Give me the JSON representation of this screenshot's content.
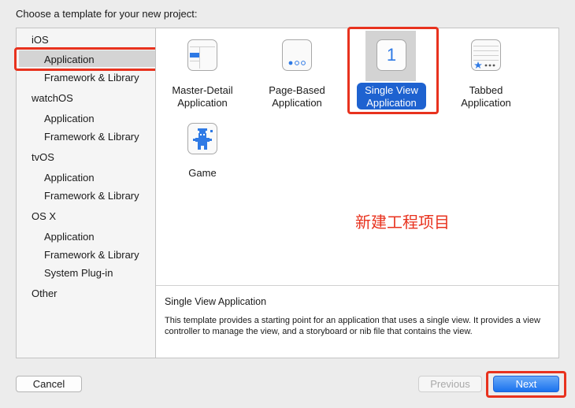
{
  "header": {
    "title": "Choose a template for your new project:"
  },
  "sidebar": {
    "items": [
      {
        "label": "iOS"
      },
      {
        "label": "Application"
      },
      {
        "label": "Framework & Library"
      },
      {
        "label": "watchOS"
      },
      {
        "label": "Application"
      },
      {
        "label": "Framework & Library"
      },
      {
        "label": "tvOS"
      },
      {
        "label": "Application"
      },
      {
        "label": "Framework & Library"
      },
      {
        "label": "OS X"
      },
      {
        "label": "Application"
      },
      {
        "label": "Framework & Library"
      },
      {
        "label": "System Plug-in"
      },
      {
        "label": "Other"
      }
    ],
    "selected": "Application"
  },
  "templates": {
    "items": [
      {
        "line1": "Master-Detail",
        "line2": "Application",
        "icon": "master-detail-icon"
      },
      {
        "line1": "Page-Based",
        "line2": "Application",
        "icon": "page-based-icon"
      },
      {
        "line1": "Single View",
        "line2": "Application",
        "icon": "single-view-icon",
        "glyph": "1"
      },
      {
        "line1": "Tabbed",
        "line2": "Application",
        "icon": "tabbed-icon"
      },
      {
        "line1": "Game",
        "line2": "",
        "icon": "game-icon"
      }
    ],
    "selected": "Single View Application"
  },
  "annotation": {
    "text": "新建工程项目"
  },
  "description": {
    "title": "Single View Application",
    "text": "This template provides a starting point for an application that uses a single view. It provides a view controller to manage the view, and a storyboard or nib file that contains the view."
  },
  "buttons": {
    "cancel": "Cancel",
    "previous": "Previous",
    "next": "Next"
  },
  "colors": {
    "highlight_red": "#e8321e",
    "selection_blue": "#1e62d0",
    "next_blue": "#1a72ee"
  }
}
